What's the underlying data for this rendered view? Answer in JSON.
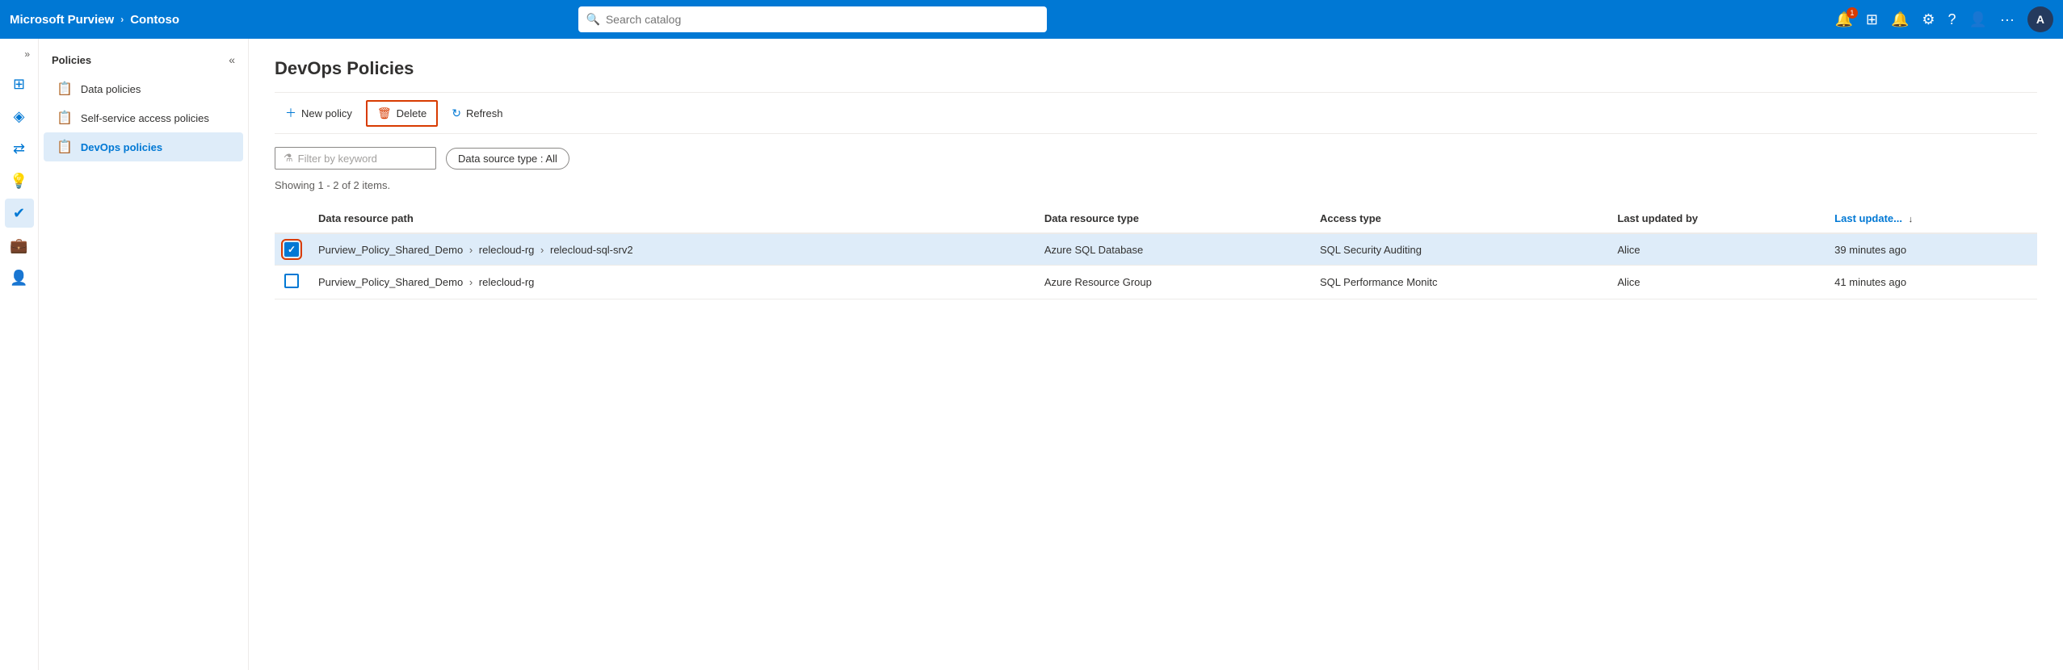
{
  "topNav": {
    "brand": "Microsoft Purview",
    "chevron": "›",
    "tenant": "Contoso",
    "search_placeholder": "Search catalog",
    "notification_badge": "1",
    "avatar_label": "A",
    "more_label": "···"
  },
  "iconSidebar": {
    "collapse_label": "»",
    "icons": [
      {
        "name": "home-icon",
        "symbol": "⊞"
      },
      {
        "name": "catalog-icon",
        "symbol": "◈"
      },
      {
        "name": "policy-icon",
        "symbol": "✔"
      },
      {
        "name": "insight-icon",
        "symbol": "💡"
      },
      {
        "name": "active-icon",
        "symbol": "✔"
      },
      {
        "name": "briefcase-icon",
        "symbol": "💼"
      },
      {
        "name": "user-icon",
        "symbol": "👤"
      }
    ]
  },
  "navPanel": {
    "title": "Policies",
    "collapse_label": "«",
    "items": [
      {
        "label": "Data policies",
        "icon": "📋",
        "active": false
      },
      {
        "label": "Self-service access policies",
        "icon": "📋",
        "active": false
      },
      {
        "label": "DevOps policies",
        "icon": "📋",
        "active": true
      }
    ]
  },
  "content": {
    "page_title": "DevOps Policies",
    "toolbar": {
      "new_policy_label": "New policy",
      "delete_label": "Delete",
      "refresh_label": "Refresh"
    },
    "filters": {
      "keyword_placeholder": "Filter by keyword",
      "data_source_label": "Data source type : All"
    },
    "showing_text": "Showing 1 - 2 of 2 items.",
    "table": {
      "columns": [
        {
          "key": "path",
          "label": "Data resource path",
          "sortable": false
        },
        {
          "key": "type",
          "label": "Data resource type",
          "sortable": false
        },
        {
          "key": "access",
          "label": "Access type",
          "sortable": false
        },
        {
          "key": "updated_by",
          "label": "Last updated by",
          "sortable": false
        },
        {
          "key": "updated",
          "label": "Last update...",
          "sortable": true
        }
      ],
      "rows": [
        {
          "selected": true,
          "path_parts": [
            "Purview_Policy_Shared_Demo",
            "relecloud-rg",
            "relecloud-sql-srv2"
          ],
          "data_resource_type": "Azure SQL Database",
          "access_type": "SQL Security Auditing",
          "updated_by": "Alice",
          "last_updated": "39 minutes ago"
        },
        {
          "selected": false,
          "path_parts": [
            "Purview_Policy_Shared_Demo",
            "relecloud-rg"
          ],
          "data_resource_type": "Azure Resource Group",
          "access_type": "SQL Performance Monitc",
          "updated_by": "Alice",
          "last_updated": "41 minutes ago"
        }
      ]
    }
  }
}
